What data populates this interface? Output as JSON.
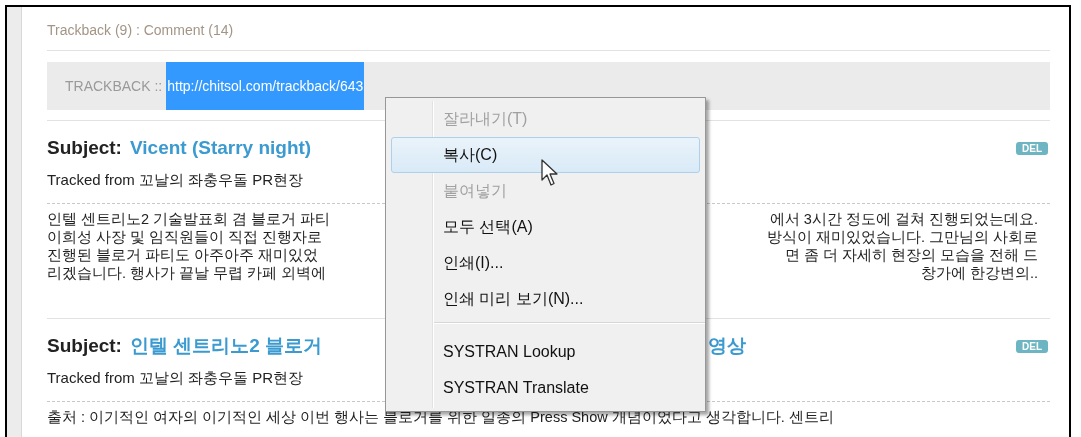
{
  "header": {
    "counts": "Trackback (9) : Comment (14)"
  },
  "trackback": {
    "label": "TRACKBACK ::",
    "url": "http://chitsol.com/trackback/643",
    "url_selected": true
  },
  "entries": [
    {
      "subject_label": "Subject:",
      "title": "Vicent (Starry night)",
      "source": "Tracked from 꼬날의 좌충우돌 PR현장",
      "delete": "DEL",
      "excerpt_lines": [
        {
          "left": "인텔 센트리노2 기술발표회 겸 블로거 파티",
          "right": "에서 3시간 정도에 걸쳐 진행되었는데요."
        },
        {
          "left": "이희성 사장 및 임직원들이 직접 진행자로",
          "right": "방식이 재미있었습니다. 그만님의 사회로"
        },
        {
          "left": "진행된 블로거 파티도 아주아주 재미있었",
          "right": "면 좀 더 자세히 현장의 모습을 전해 드"
        },
        {
          "left": "리겠습니다. 행사가 끝날 무렵 카페 외벽에",
          "right": "창가에 한강변의.."
        }
      ]
    },
    {
      "subject_label": "Subject:",
      "title": "인텔 센트리노2 블로거",
      "title_tail": "영상",
      "source": "Tracked from 꼬날의 좌충우돌 PR현장",
      "delete": "DEL",
      "excerpt_lines": [
        {
          "left": "출처 : 이기적인 여자의 이기적인 세상 이번 행사는 블로거를 위한 일종의 Press Show 개념이었다고 생각합니다. 센트리"
        }
      ]
    }
  ],
  "context_menu": {
    "items": [
      {
        "kind": "item",
        "label": "잘라내기(T)",
        "disabled": true,
        "selected": false
      },
      {
        "kind": "item",
        "label": "복사(C)",
        "disabled": false,
        "selected": true
      },
      {
        "kind": "item",
        "label": "붙여넣기",
        "disabled": true,
        "selected": false
      },
      {
        "kind": "item",
        "label": "모두 선택(A)",
        "disabled": false,
        "selected": false
      },
      {
        "kind": "item",
        "label": "인쇄(I)...",
        "disabled": false,
        "selected": false
      },
      {
        "kind": "item",
        "label": "인쇄 미리 보기(N)...",
        "disabled": false,
        "selected": false
      },
      {
        "kind": "separator"
      },
      {
        "kind": "item",
        "label": "SYSTRAN Lookup",
        "disabled": false,
        "selected": false
      },
      {
        "kind": "item",
        "label": "SYSTRAN Translate",
        "disabled": false,
        "selected": false
      }
    ]
  }
}
